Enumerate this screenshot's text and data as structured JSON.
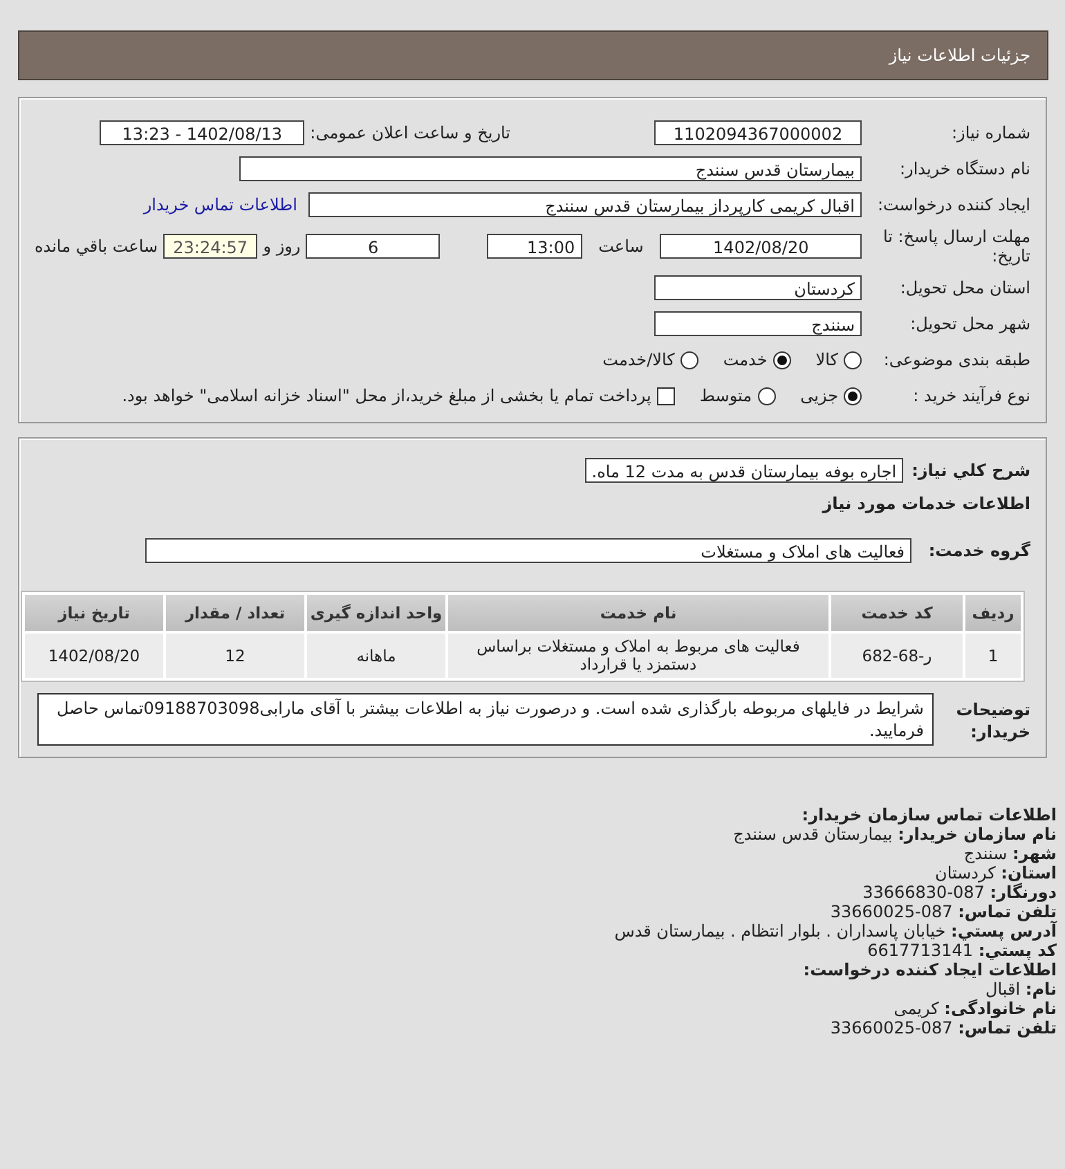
{
  "header": {
    "title": "جزئیات اطلاعات نیاز"
  },
  "details": {
    "need_number": {
      "label": "شماره نیاز:",
      "value": "1102094367000002"
    },
    "announce": {
      "label": "تاریخ و ساعت اعلان عمومی:",
      "value": "1402/08/13 - 13:23"
    },
    "buyer": {
      "label": "نام دستگاه خریدار:",
      "value": "بیمارستان قدس سنندج"
    },
    "creator": {
      "label": "ایجاد کننده درخواست:",
      "value": "اقبال کریمی کارپرداز بیمارستان قدس سنندج"
    },
    "contact_link": "اطلاعات تماس خریدار",
    "deadline": {
      "label": "مهلت ارسال پاسخ: تا تاریخ:",
      "date": "1402/08/20",
      "time_label": "ساعت",
      "time": "13:00",
      "days": "6",
      "days_label": "روز و",
      "remaining": "23:24:57",
      "remaining_label": "ساعت باقي مانده"
    },
    "province": {
      "label": "استان محل تحویل:",
      "value": "کردستان"
    },
    "city": {
      "label": "شهر محل تحویل:",
      "value": "سنندج"
    },
    "category": {
      "label": "طبقه بندی موضوعی:",
      "options": [
        {
          "label": "کالا",
          "selected": false
        },
        {
          "label": "خدمت",
          "selected": true
        },
        {
          "label": "کالا/خدمت",
          "selected": false
        }
      ]
    },
    "process": {
      "label": "نوع فرآیند خرید :",
      "options": [
        {
          "label": "جزیی",
          "selected": true
        },
        {
          "label": "متوسط",
          "selected": false
        }
      ],
      "treasury": {
        "checked": false,
        "text": "پرداخت تمام یا بخشی از مبلغ خرید،از محل \"اسناد خزانه اسلامی\" خواهد بود."
      }
    }
  },
  "needs": {
    "summary_label": "شرح کلي نياز:",
    "summary": "اجاره بوفه بیمارستان قدس به مدت 12 ماه.",
    "services_heading": "اطلاعات خدمات مورد نیاز",
    "group_label": "گروه خدمت:",
    "group": "فعالیت های  املاک و مستغلات",
    "table": {
      "columns": [
        "ردیف",
        "کد خدمت",
        "نام خدمت",
        "واحد اندازه گیری",
        "تعداد / مقدار",
        "تاریخ نیاز"
      ],
      "rows": [
        [
          "1",
          "ر-68-682",
          "فعالیت های مربوط به املاک و مستغلات براساس دستمزد یا قرارداد",
          "ماهانه",
          "12",
          "1402/08/20"
        ]
      ]
    },
    "notes_label": "توضیحات خریدار:",
    "notes": "شرایط در فایلهای مربوطه بارگذاری شده است. و درصورت نیاز به اطلاعات بیشتر با آقای مارابی09188703098تماس حاصل فرمایید."
  },
  "contact": [
    {
      "label": "اطلاعات تماس سازمان خریدار:"
    },
    {
      "label": "نام سازمان خریدار:",
      "value": "بیمارستان قدس سنندج"
    },
    {
      "label": "شهر:",
      "value": "سنندج"
    },
    {
      "label": "استان:",
      "value": "کردستان"
    },
    {
      "label": "دورنگار:",
      "value": "087-33666830"
    },
    {
      "label": "تلفن تماس:",
      "value": "087-33660025"
    },
    {
      "label": "آدرس پستي:",
      "value": "خیابان پاسداران . بلوار انتظام . بیمارستان قدس"
    },
    {
      "label": "کد پستي:",
      "value": "6617713141"
    },
    {
      "label": "اطلاعات ایجاد کننده درخواست:"
    },
    {
      "label": "نام:",
      "value": "اقبال"
    },
    {
      "label": "نام خانوادگی:",
      "value": "کریمی"
    },
    {
      "label": "تلفن تماس:",
      "value": "087-33660025"
    }
  ]
}
